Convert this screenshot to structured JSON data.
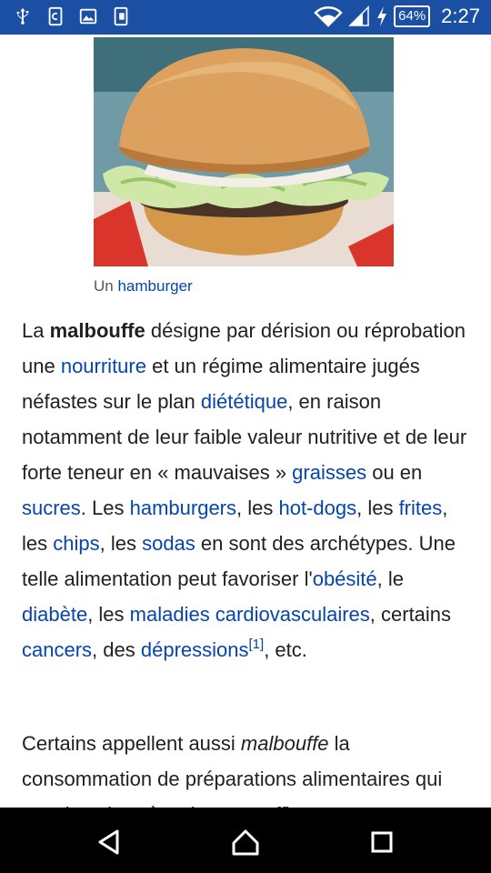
{
  "status_bar": {
    "battery": "64%",
    "time": "2:27"
  },
  "figure": {
    "caption_prefix": "Un",
    "caption_link": "hamburger"
  },
  "article": {
    "p1": {
      "t1": "La ",
      "bold": "malbouffe",
      "t2": " désigne par dérision ou réprobation une ",
      "l_nourriture": "nourriture",
      "t3": " et un régime alimentaire jugés néfastes sur le plan ",
      "l_dietetique": "diététique",
      "t4": ", en raison notamment de leur faible valeur nutritive et de leur forte teneur en « mauvaises » ",
      "l_graisses": "graisses",
      "t5": " ou en ",
      "l_sucres": "sucres",
      "t6": ". Les ",
      "l_hamburgers": "hamburgers",
      "t7": ", les ",
      "l_hotdogs": "hot-dogs",
      "t8": ", les ",
      "l_frites": "frites",
      "t9": ", les ",
      "l_chips": "chips",
      "t10": ", les ",
      "l_sodas": "sodas",
      "t11": " en sont des archétypes. Une telle alimentation peut favoriser l'",
      "l_obesite": "obésité",
      "t12": ", le ",
      "l_diabete": "diabète",
      "t13": ", les ",
      "l_maladies": "maladies cardiovasculaires",
      "t14": ", certains ",
      "l_cancers": "cancers",
      "t15": ", des ",
      "l_depressions": "dépressions",
      "ref": "[1]",
      "t16": ", etc."
    },
    "p2": {
      "t1": "Certains appellent aussi ",
      "italic": "malbouffe",
      "t2": " la consommation de préparations alimentaires",
      "t3": "qui sont les plus sà ... (text cut off)"
    }
  },
  "nav_bar": {
    "back": "back-icon",
    "home": "home-icon",
    "recent": "recent-apps-icon"
  }
}
